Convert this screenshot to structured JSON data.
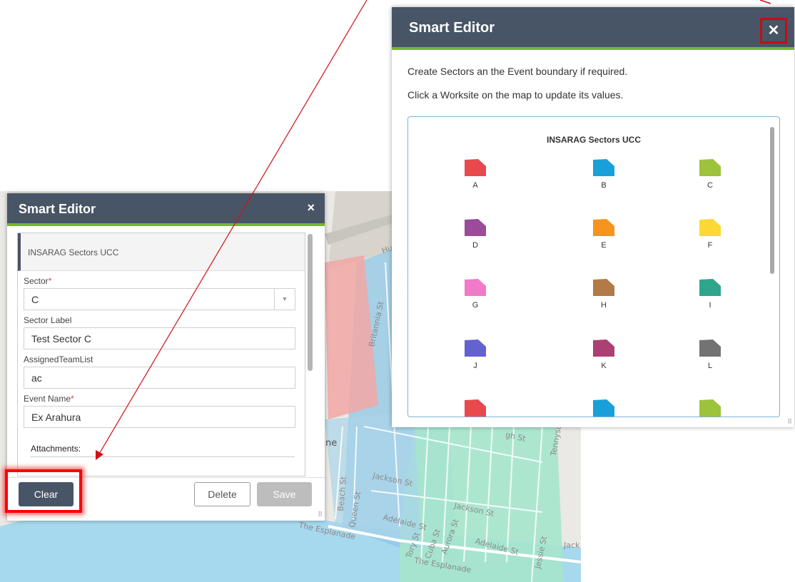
{
  "map": {
    "street_labels": [
      "Hu",
      "Britannia St",
      "ne",
      "Jackson St",
      "Jackson St",
      "Beach St",
      "Queen St",
      "Adelaide St",
      "Tory St",
      "Cuba St",
      "Aurora St",
      "Adelaide St",
      "Tennyson St",
      "gh St",
      "The Esplanade",
      "The Esplanade",
      "Jessie St",
      "Jack"
    ]
  },
  "left_panel": {
    "title": "Smart Editor",
    "close_glyph": "×",
    "template_name": "INSARAG Sectors UCC",
    "fields": [
      {
        "label": "Sector",
        "required": "*",
        "value": "C"
      },
      {
        "label": "Sector Label",
        "required": "",
        "value": "Test Sector C"
      },
      {
        "label": "AssignedTeamList",
        "required": "",
        "value": "ac"
      },
      {
        "label": "Event Name",
        "required": "*",
        "value": "Ex Arahura"
      }
    ],
    "dropdown_arrow": "▼",
    "attachments_label": "Attachments:",
    "buttons": {
      "clear": "Clear",
      "delete": "Delete",
      "save": "Save"
    }
  },
  "right_panel": {
    "title": "Smart Editor",
    "close_glyph": "✕",
    "instruction_1": "Create Sectors an the Event boundary if required.",
    "instruction_2": "Click a Worksite on the map to update its values.",
    "template_title": "INSARAG Sectors UCC",
    "templates": [
      {
        "label": "A",
        "color": "#e8494e"
      },
      {
        "label": "B",
        "color": "#1aa0d8"
      },
      {
        "label": "C",
        "color": "#9cc33b"
      },
      {
        "label": "D",
        "color": "#9b4b98"
      },
      {
        "label": "E",
        "color": "#f7941d"
      },
      {
        "label": "F",
        "color": "#fdd835"
      },
      {
        "label": "G",
        "color": "#f17bc8"
      },
      {
        "label": "H",
        "color": "#b27a46"
      },
      {
        "label": "I",
        "color": "#2fa58c"
      },
      {
        "label": "J",
        "color": "#6461d1"
      },
      {
        "label": "K",
        "color": "#ac4075"
      },
      {
        "label": "L",
        "color": "#737373"
      },
      {
        "label": "",
        "color": "#e8494e"
      },
      {
        "label": "",
        "color": "#1aa0d8"
      },
      {
        "label": "",
        "color": "#9cc33b"
      }
    ]
  },
  "colors": {
    "header": "#485566",
    "accent": "#76b82a",
    "highlight": "#ff0000",
    "arrow": "#d0101a"
  },
  "icons": [
    "close-icon",
    "dropdown-arrow-icon",
    "resize-handle-icon"
  ]
}
